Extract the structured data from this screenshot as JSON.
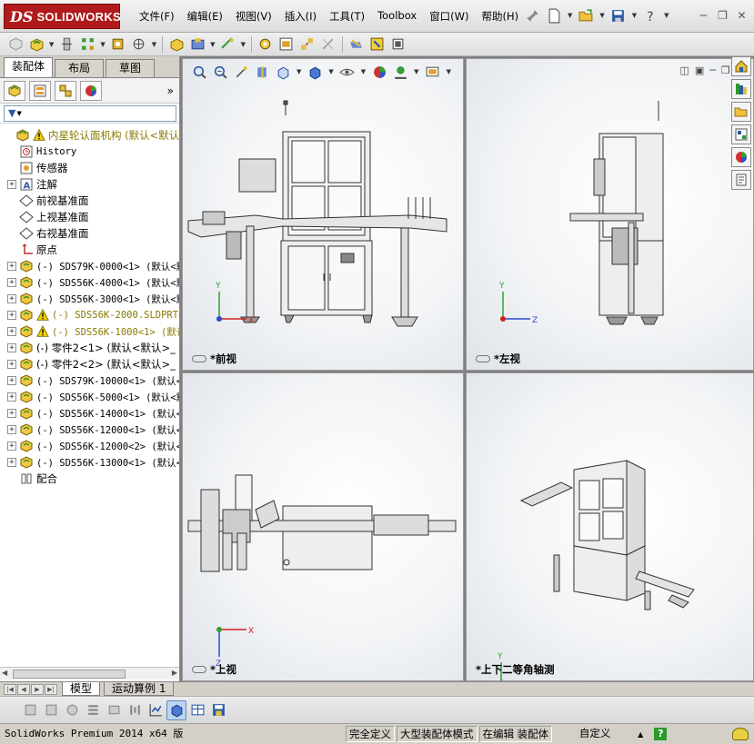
{
  "app": {
    "logo_ds": "DS",
    "logo_text": "SOLIDWORKS",
    "brand_color": "#b01a1a"
  },
  "menu": [
    "文件(F)",
    "编辑(E)",
    "视图(V)",
    "插入(I)",
    "工具(T)",
    "Toolbox",
    "窗口(W)",
    "帮助(H)"
  ],
  "left_panel": {
    "tabs": [
      "装配体",
      "布局",
      "草图"
    ],
    "active_tab": "装配体",
    "collapse_label": "»",
    "tree": [
      {
        "label": "内星轮认面机构  (默认<默认>",
        "icon": "assembly-icon",
        "warn": true,
        "color": "olive",
        "indent": 0,
        "expand": "none"
      },
      {
        "label": "History",
        "icon": "history-icon",
        "indent": 1,
        "expand": "none",
        "mono": true
      },
      {
        "label": "传感器",
        "icon": "sensor-icon",
        "indent": 1,
        "expand": "none"
      },
      {
        "label": "注解",
        "icon": "annotation-icon",
        "indent": 1,
        "expand": "+"
      },
      {
        "label": "前视基准面",
        "icon": "plane-icon",
        "indent": 1,
        "expand": "none"
      },
      {
        "label": "上视基准面",
        "icon": "plane-icon",
        "indent": 1,
        "expand": "none"
      },
      {
        "label": "右视基准面",
        "icon": "plane-icon",
        "indent": 1,
        "expand": "none"
      },
      {
        "label": "原点",
        "icon": "origin-icon",
        "indent": 1,
        "expand": "none"
      },
      {
        "label": "(-) SDS79K-0000<1> (默认<默",
        "icon": "subassembly-icon",
        "indent": 1,
        "expand": "+",
        "mono": true
      },
      {
        "label": "(-) SDS56K-4000<1> (默认<默",
        "icon": "subassembly-icon",
        "indent": 1,
        "expand": "+",
        "mono": true
      },
      {
        "label": "(-) SDS56K-3000<1> (默认<默",
        "icon": "subassembly-icon",
        "indent": 1,
        "expand": "+",
        "mono": true
      },
      {
        "label": "(-) SDS56K-2000.SLDPRT<",
        "icon": "subassembly-icon",
        "indent": 1,
        "expand": "+",
        "mono": true,
        "warn": true,
        "color": "olive"
      },
      {
        "label": "(-) SDS56K-1000<1> (默认",
        "icon": "subassembly-icon",
        "indent": 1,
        "expand": "+",
        "mono": true,
        "warn": true,
        "color": "olive"
      },
      {
        "label": "(-) 零件2<1> (默认<默认>_",
        "icon": "subassembly-icon",
        "indent": 1,
        "expand": "+"
      },
      {
        "label": "(-) 零件2<2> (默认<默认>_",
        "icon": "subassembly-icon",
        "indent": 1,
        "expand": "+"
      },
      {
        "label": "(-) SDS79K-10000<1> (默认<",
        "icon": "subassembly-icon",
        "indent": 1,
        "expand": "+",
        "mono": true
      },
      {
        "label": "(-) SDS56K-5000<1> (默认<默",
        "icon": "subassembly-icon",
        "indent": 1,
        "expand": "+",
        "mono": true
      },
      {
        "label": "(-) SDS56K-14000<1> (默认<",
        "icon": "subassembly-icon",
        "indent": 1,
        "expand": "+",
        "mono": true
      },
      {
        "label": "(-) SDS56K-12000<1> (默认<",
        "icon": "subassembly-icon",
        "indent": 1,
        "expand": "+",
        "mono": true
      },
      {
        "label": "(-) SDS56K-12000<2> (默认<",
        "icon": "subassembly-icon",
        "indent": 1,
        "expand": "+",
        "mono": true
      },
      {
        "label": "(-) SDS56K-13000<1> (默认<",
        "icon": "subassembly-icon",
        "indent": 1,
        "expand": "+",
        "mono": true
      },
      {
        "label": "配合",
        "icon": "mates-icon",
        "indent": 1,
        "expand": "none"
      }
    ]
  },
  "viewports": {
    "front": "*前视",
    "left": "*左视",
    "top": "*上视",
    "iso": "*上下二等角轴测"
  },
  "axes": {
    "x": "X",
    "y": "Y",
    "z": "Z"
  },
  "bottom_tabs": [
    "模型",
    "运动算例 1"
  ],
  "active_bottom_tab": "模型",
  "status": {
    "product": "SolidWorks Premium 2014 x64 版",
    "fully_defined": "完全定义",
    "large_assembly": "大型装配体模式",
    "editing": "在编辑 装配体",
    "custom": "自定义",
    "help": "?"
  }
}
